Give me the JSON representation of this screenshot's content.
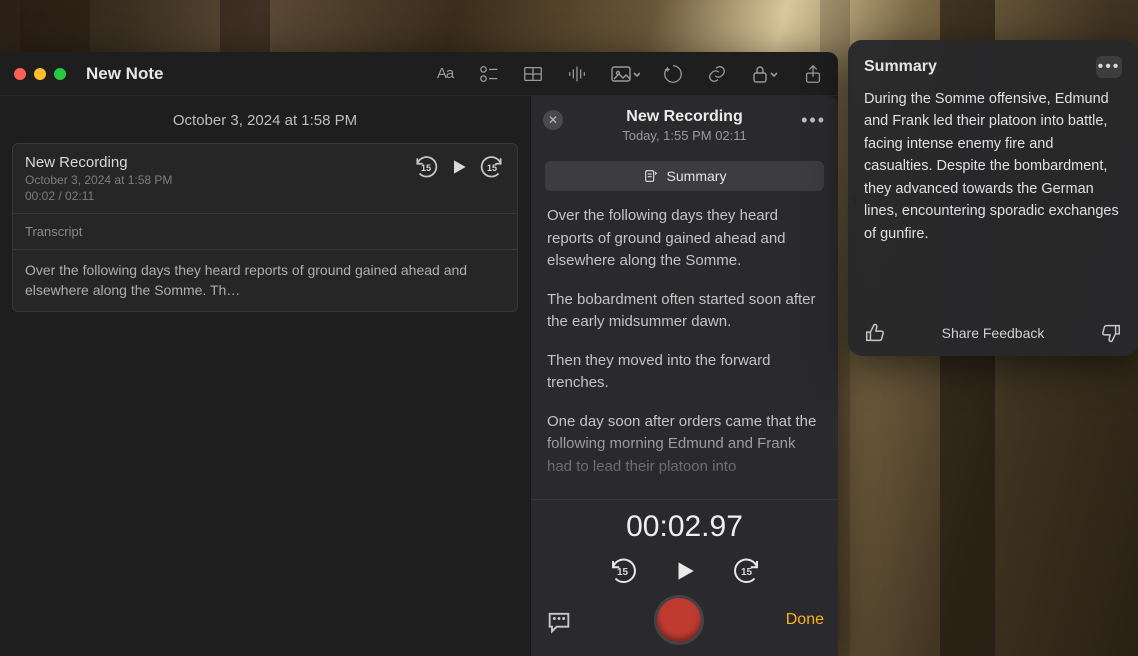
{
  "window": {
    "title": "New Note"
  },
  "note": {
    "timestamp": "October 3, 2024 at 1:58 PM",
    "recording_card": {
      "title": "New Recording",
      "subtitle": "October 3, 2024 at 1:58 PM",
      "elapsed": "00:02 / 02:11",
      "skip_back_seconds": "15",
      "skip_fwd_seconds": "15",
      "transcript_label": "Transcript",
      "excerpt": "Over the following days they heard reports of ground gained ahead and elsewhere along the Somme. Th…"
    }
  },
  "rec_panel": {
    "title": "New Recording",
    "subtitle": "Today, 1:55 PM   02:11",
    "summary_button": "Summary",
    "paras": {
      "p1": "Over the following days they heard reports of ground gained ahead and elsewhere along the Somme.",
      "p2": "The bobardment often started soon after the early midsummer dawn.",
      "p3": "Then they moved into the forward trenches.",
      "p4": "One day soon after orders came that the following morning Edmund and Frank had to lead their platoon into"
    },
    "timer": "00:02.97",
    "skip_back_seconds": "15",
    "skip_fwd_seconds": "15",
    "done_label": "Done"
  },
  "popover": {
    "title": "Summary",
    "body": "During the Somme offensive, Edmund and Frank led their platoon into battle, facing intense enemy fire and casualties. Despite the bombardment, they advanced towards the German lines, encountering sporadic exchanges of gunfire.",
    "share_label": "Share Feedback"
  },
  "colors": {
    "accent": "#ffb020",
    "record": "#bf3b30"
  }
}
